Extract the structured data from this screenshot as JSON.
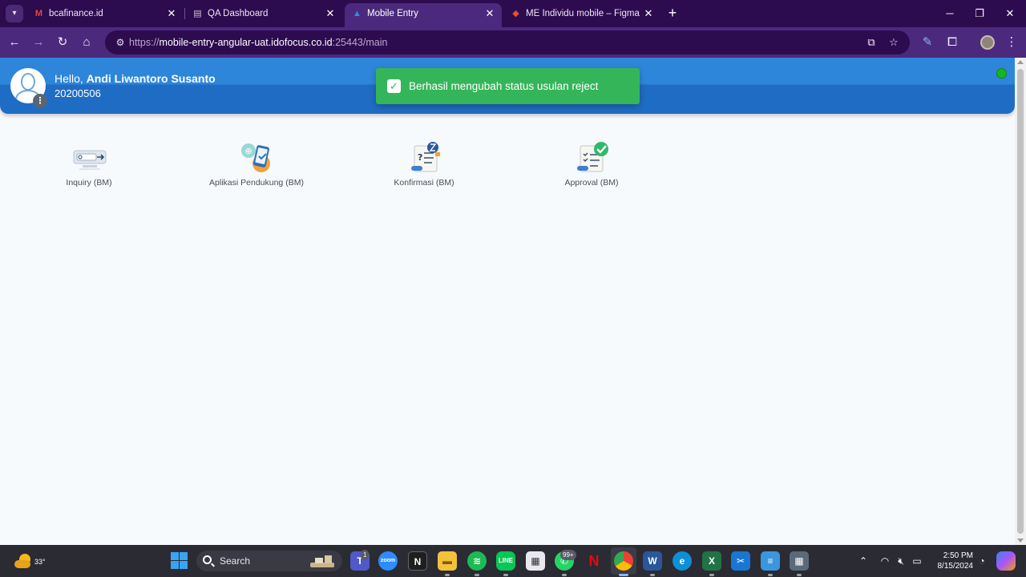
{
  "browser": {
    "tabs": [
      {
        "title": "bcafinance.id",
        "favicon": "gmail-icon",
        "active": false
      },
      {
        "title": "QA Dashboard",
        "favicon": "doc-icon",
        "active": false
      },
      {
        "title": "Mobile Entry",
        "favicon": "angular-icon",
        "active": true
      },
      {
        "title": "ME Individu mobile – Figma",
        "favicon": "figma-icon",
        "active": false
      }
    ],
    "url": {
      "scheme": "https://",
      "host": "mobile-entry-angular-uat.idofocus.co.id",
      "rest": ":25443/main"
    },
    "theme_color": "#4b2a7d",
    "tabbar_color": "#2d0b4f"
  },
  "app": {
    "header": {
      "greeting_prefix": "Hello,",
      "user_name": "Andi Liwantoro Susanto",
      "user_id": "20200506",
      "status": "online",
      "colors": {
        "header": "#2d86d9",
        "status_dot": "#19b51c"
      }
    },
    "toast": {
      "message": "Berhasil mengubah status usulan reject",
      "type": "success",
      "color": "#35b55a"
    },
    "menu": [
      {
        "label": "Inquiry (BM)",
        "icon": "inquiry-monitor-icon"
      },
      {
        "label": "Aplikasi Pendukung (BM)",
        "icon": "mobile-app-icon"
      },
      {
        "label": "Konfirmasi (BM)",
        "icon": "confirmation-checklist-icon"
      },
      {
        "label": "Approval (BM)",
        "icon": "approval-checklist-icon"
      }
    ]
  },
  "taskbar": {
    "weather_temp": "33°",
    "search_placeholder": "Search",
    "teams_badge": "1",
    "whatsapp_badge": "99+",
    "clock_time": "2:50 PM",
    "clock_date": "8/15/2024"
  }
}
